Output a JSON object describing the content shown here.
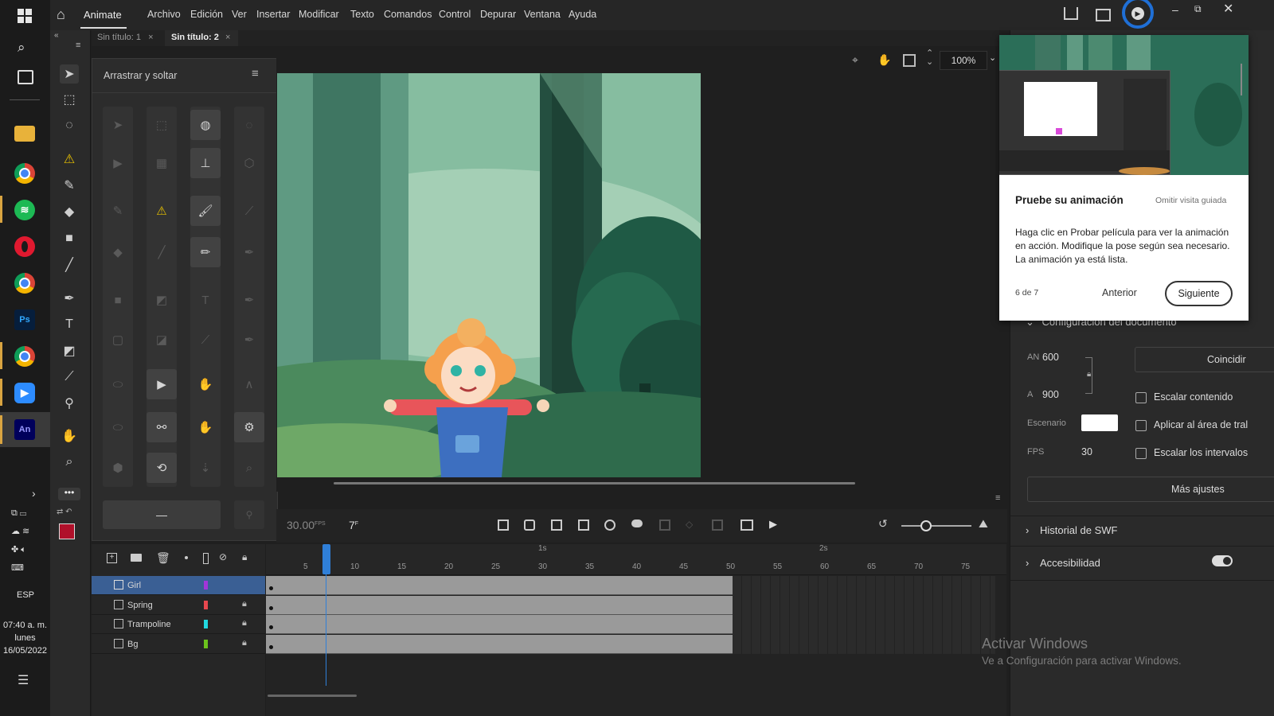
{
  "app": {
    "name": "Animate",
    "badge": "An"
  },
  "menu": [
    "Archivo",
    "Edición",
    "Ver",
    "Insertar",
    "Modificar",
    "Texto",
    "Comandos",
    "Control",
    "Depurar",
    "Ventana",
    "Ayuda"
  ],
  "tabs": [
    {
      "label": "Sin título: 1",
      "close": "×"
    },
    {
      "label": "Sin título: 2",
      "close": "×"
    }
  ],
  "dragdrop": {
    "title": "Arrastrar y soltar",
    "bottom_button": "—"
  },
  "stage": {
    "zoom": "100%"
  },
  "tour": {
    "title": "Pruebe su animación",
    "skip": "Omitir visita guiada",
    "body": "Haga clic en Probar película para ver la animación en acción. Modifique la pose según sea necesario. La animación ya está lista.",
    "step": "6 de 7",
    "prev": "Anterior",
    "next": "Siguiente"
  },
  "properties": {
    "section": "Configuración del documento",
    "width_label": "AN",
    "width_value": "600",
    "height_label": "A",
    "height_value": "900",
    "stage_label": "Escenario",
    "fps_label": "FPS",
    "fps_value": "30",
    "match_button": "Coincidir",
    "scale_content": "Escalar contenido",
    "apply_area": "Aplicar al área de tral",
    "scale_intervals": "Escalar los intervalos",
    "more_settings": "Más ajustes",
    "swf_history": "Historial de SWF",
    "accessibility": "Accesibilidad"
  },
  "timeline": {
    "fps": "30.00",
    "fps_unit": "FPS",
    "frame": "7",
    "frame_unit": "F",
    "ruler": [
      "5",
      "10",
      "15",
      "20",
      "25",
      "30",
      "35",
      "40",
      "45",
      "50",
      "55",
      "60",
      "65",
      "70",
      "75"
    ],
    "seconds": [
      "1s",
      "2s"
    ],
    "layers": [
      {
        "name": "Girl",
        "color": "#a335d9",
        "locked": false,
        "selected": true
      },
      {
        "name": "Spring",
        "color": "#e8474f",
        "locked": true,
        "selected": false
      },
      {
        "name": "Trampoline",
        "color": "#21d8e0",
        "locked": true,
        "selected": false
      },
      {
        "name": "Bg",
        "color": "#6bc21c",
        "locked": true,
        "selected": false
      }
    ]
  },
  "watermark": {
    "title": "Activar Windows",
    "subtitle": "Ve a Configuración para activar Windows."
  },
  "system": {
    "lang": "ESP",
    "time": "07:40 a. m.",
    "day": "lunes",
    "date": "16/05/2022"
  },
  "colors": {
    "accent": "#3a5f94",
    "stroke_swatch": "#b0102a",
    "tour_ring": "#1f6fd6"
  }
}
